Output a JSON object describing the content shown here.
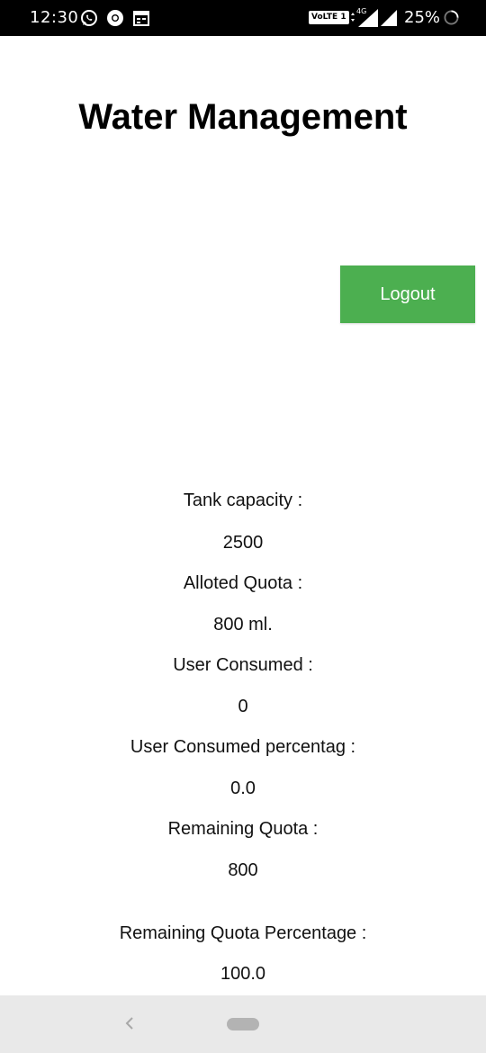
{
  "status_bar": {
    "time": "12:30",
    "volte_label": "VoLTE 1",
    "network_label": "4G",
    "battery": "25%",
    "icons": [
      "whatsapp-icon",
      "chrome-icon",
      "calendar-icon",
      "signal-icon",
      "battery-icon"
    ]
  },
  "app": {
    "title": "Water Management",
    "logout_label": "Logout",
    "accent_color": "#4caf50"
  },
  "stats": [
    {
      "label": "Tank capacity :",
      "value": "2500"
    },
    {
      "label": "Alloted Quota :",
      "value": "800 ml."
    },
    {
      "label": "User Consumed :",
      "value": "0"
    },
    {
      "label": "User Consumed percentag :",
      "value": "0.0"
    },
    {
      "label": "Remaining Quota :",
      "value": "800"
    },
    {
      "label": "Remaining Quota Percentage :",
      "value": "100.0"
    }
  ]
}
